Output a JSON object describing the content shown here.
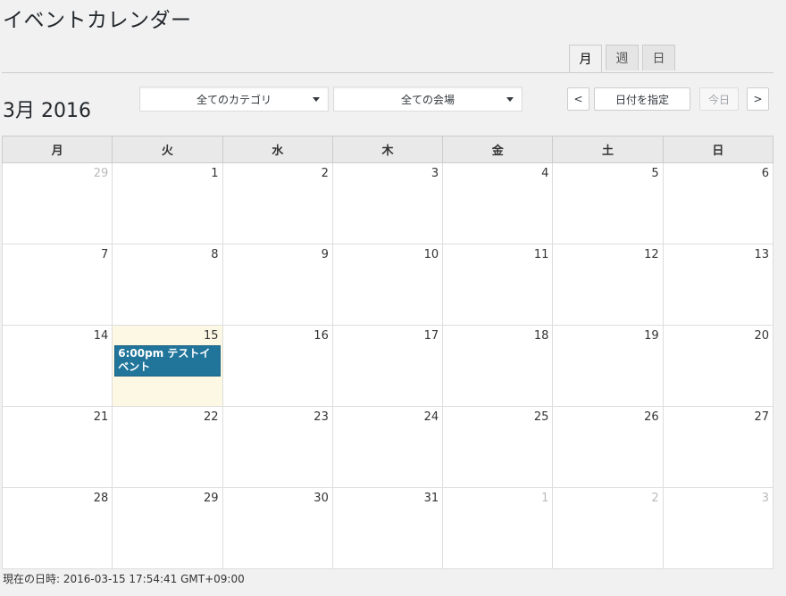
{
  "page": {
    "title": "イベントカレンダー"
  },
  "view_tabs": [
    {
      "label": "月",
      "active": true
    },
    {
      "label": "週",
      "active": false
    },
    {
      "label": "日",
      "active": false
    }
  ],
  "toolbar": {
    "month_title": "3月 2016",
    "category_select": "全てのカテゴリ",
    "venue_select": "全ての会場",
    "prev_label": "<",
    "date_picker_label": "日付を指定",
    "today_label": "今日",
    "next_label": ">"
  },
  "weekdays": [
    "月",
    "火",
    "水",
    "木",
    "金",
    "土",
    "日"
  ],
  "weeks": [
    [
      {
        "day": "29",
        "other": true
      },
      {
        "day": "1"
      },
      {
        "day": "2"
      },
      {
        "day": "3"
      },
      {
        "day": "4"
      },
      {
        "day": "5"
      },
      {
        "day": "6"
      }
    ],
    [
      {
        "day": "7"
      },
      {
        "day": "8"
      },
      {
        "day": "9"
      },
      {
        "day": "10"
      },
      {
        "day": "11"
      },
      {
        "day": "12"
      },
      {
        "day": "13"
      }
    ],
    [
      {
        "day": "14"
      },
      {
        "day": "15",
        "today": true,
        "events": [
          "6:00pm テストイベント"
        ]
      },
      {
        "day": "16"
      },
      {
        "day": "17"
      },
      {
        "day": "18"
      },
      {
        "day": "19"
      },
      {
        "day": "20"
      }
    ],
    [
      {
        "day": "21"
      },
      {
        "day": "22"
      },
      {
        "day": "23"
      },
      {
        "day": "24"
      },
      {
        "day": "25"
      },
      {
        "day": "26"
      },
      {
        "day": "27"
      }
    ],
    [
      {
        "day": "28"
      },
      {
        "day": "29"
      },
      {
        "day": "30"
      },
      {
        "day": "31"
      },
      {
        "day": "1",
        "other": true
      },
      {
        "day": "2",
        "other": true
      },
      {
        "day": "3",
        "other": true
      }
    ]
  ],
  "footer": {
    "current_time": "現在の日時: 2016-03-15 17:54:41 GMT+09:00"
  },
  "colors": {
    "event_bg": "#21759b",
    "today_bg": "#fcf8e3"
  }
}
